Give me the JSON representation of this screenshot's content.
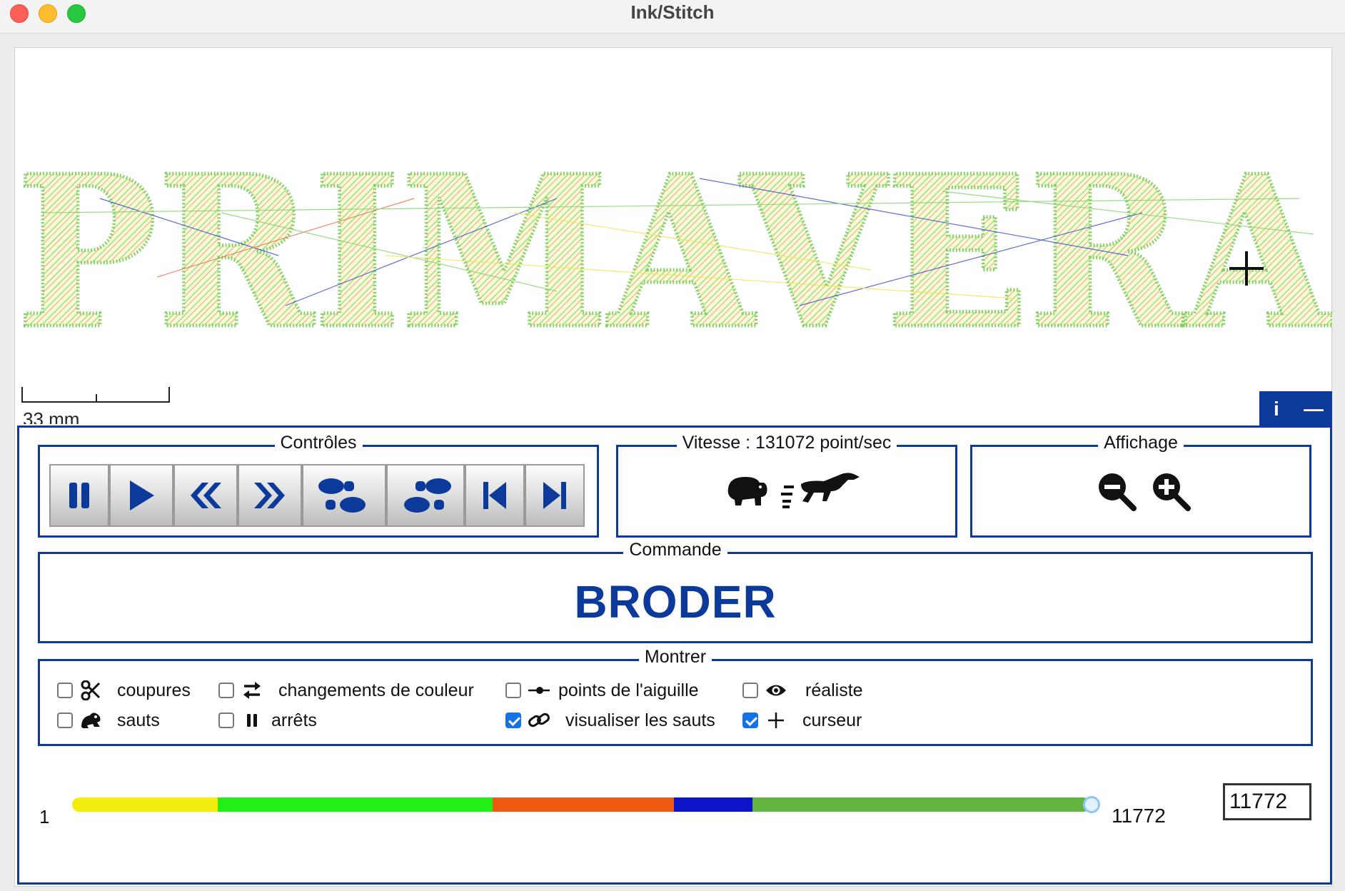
{
  "window": {
    "title": "Ink/Stitch"
  },
  "canvas": {
    "design_text": "PRIMAVERA",
    "scale_label": "33 mm",
    "info_button": "i",
    "minimize_button": "—"
  },
  "controls": {
    "legend": "Contrôles",
    "buttons": [
      {
        "name": "pause",
        "icon": "pause-icon"
      },
      {
        "name": "play",
        "icon": "play-icon"
      },
      {
        "name": "rewind",
        "icon": "double-chevron-left-icon"
      },
      {
        "name": "fast-forward",
        "icon": "double-chevron-right-icon"
      },
      {
        "name": "step-back",
        "icon": "footprints-back-icon"
      },
      {
        "name": "step-forward",
        "icon": "footprints-forward-icon"
      },
      {
        "name": "go-to-start",
        "icon": "skip-start-icon"
      },
      {
        "name": "go-to-end",
        "icon": "skip-end-icon"
      }
    ]
  },
  "speed": {
    "legend": "Vitesse : 131072 point/sec",
    "slower_icon": "hippo-icon",
    "faster_icon": "running-horse-icon"
  },
  "display": {
    "legend": "Affichage",
    "zoom_out_icon": "zoom-out-icon",
    "zoom_in_icon": "zoom-in-icon"
  },
  "command": {
    "legend": "Commande",
    "value": "BRODER"
  },
  "show": {
    "legend": "Montrer",
    "options": [
      {
        "key": "coupures",
        "label": "coupures",
        "checked": false,
        "icon": "scissors-icon"
      },
      {
        "key": "sauts",
        "label": "sauts",
        "checked": false,
        "icon": "frog-icon"
      },
      {
        "key": "changements",
        "label": "changements de couleur",
        "checked": false,
        "icon": "swap-arrows-icon"
      },
      {
        "key": "arrets",
        "label": "arrêts",
        "checked": false,
        "icon": "pause-icon"
      },
      {
        "key": "points",
        "label": "points de l'aiguille",
        "checked": false,
        "icon": "needle-point-icon"
      },
      {
        "key": "visualiser",
        "label": "visualiser les sauts",
        "checked": true,
        "icon": "link-icon"
      },
      {
        "key": "realiste",
        "label": "réaliste",
        "checked": false,
        "icon": "eye-icon"
      },
      {
        "key": "curseur",
        "label": "curseur",
        "checked": true,
        "icon": "crosshair-icon"
      }
    ]
  },
  "slider": {
    "min": "1",
    "max": "11772",
    "current": "11772",
    "position_fraction": 1.0,
    "color_segments": [
      {
        "color": "#f4ee0e",
        "fraction": 0.143
      },
      {
        "color": "#21ef16",
        "fraction": 0.27
      },
      {
        "color": "#ef5a12",
        "fraction": 0.178
      },
      {
        "color": "#0d14c8",
        "fraction": 0.077
      },
      {
        "color": "#63b340",
        "fraction": 0.332
      }
    ]
  },
  "colors": {
    "accent": "#0b3a9b",
    "checkbox_on": "#1673e6"
  }
}
